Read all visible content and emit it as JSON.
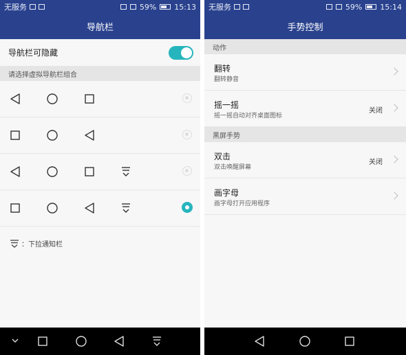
{
  "left": {
    "status": {
      "carrier": "无服务",
      "battery": "59%",
      "time": "15:13"
    },
    "title": "导航栏",
    "toggle_row": {
      "label": "导航栏可隐藏",
      "enabled": true
    },
    "section_label": "请选择虚拟导航栏组合",
    "combinations": [
      {
        "icons": [
          "back-icon",
          "home-icon",
          "recent-icon"
        ],
        "selected": false
      },
      {
        "icons": [
          "recent-icon",
          "home-icon",
          "back-icon"
        ],
        "selected": false
      },
      {
        "icons": [
          "back-icon",
          "home-icon",
          "recent-icon",
          "pulldown-icon"
        ],
        "selected": false
      },
      {
        "icons": [
          "recent-icon",
          "home-icon",
          "back-icon",
          "pulldown-icon"
        ],
        "selected": true
      }
    ],
    "legend_text": "：下拉通知栏",
    "navbar_icons": [
      "hide-chevron-icon",
      "recent-icon",
      "home-icon",
      "back-icon",
      "pulldown-icon"
    ]
  },
  "right": {
    "status": {
      "carrier": "无服务",
      "battery": "59%",
      "time": "15:14"
    },
    "title": "手势控制",
    "sections": [
      {
        "header": "动作",
        "items": [
          {
            "title": "翻转",
            "subtitle": "翻转静音",
            "value": ""
          },
          {
            "title": "摇一摇",
            "subtitle": "摇一摇自动对齐桌面图标",
            "value": "关闭"
          }
        ]
      },
      {
        "header": "黑屏手势",
        "items": [
          {
            "title": "双击",
            "subtitle": "双击唤醒屏幕",
            "value": "关闭"
          },
          {
            "title": "画字母",
            "subtitle": "画字母打开应用程序",
            "value": ""
          }
        ]
      }
    ],
    "navbar_icons": [
      "back-icon",
      "home-icon",
      "recent-icon"
    ]
  },
  "colors": {
    "appbar": "#2a428e",
    "accent": "#26b5bd",
    "navbar": "#000000"
  }
}
